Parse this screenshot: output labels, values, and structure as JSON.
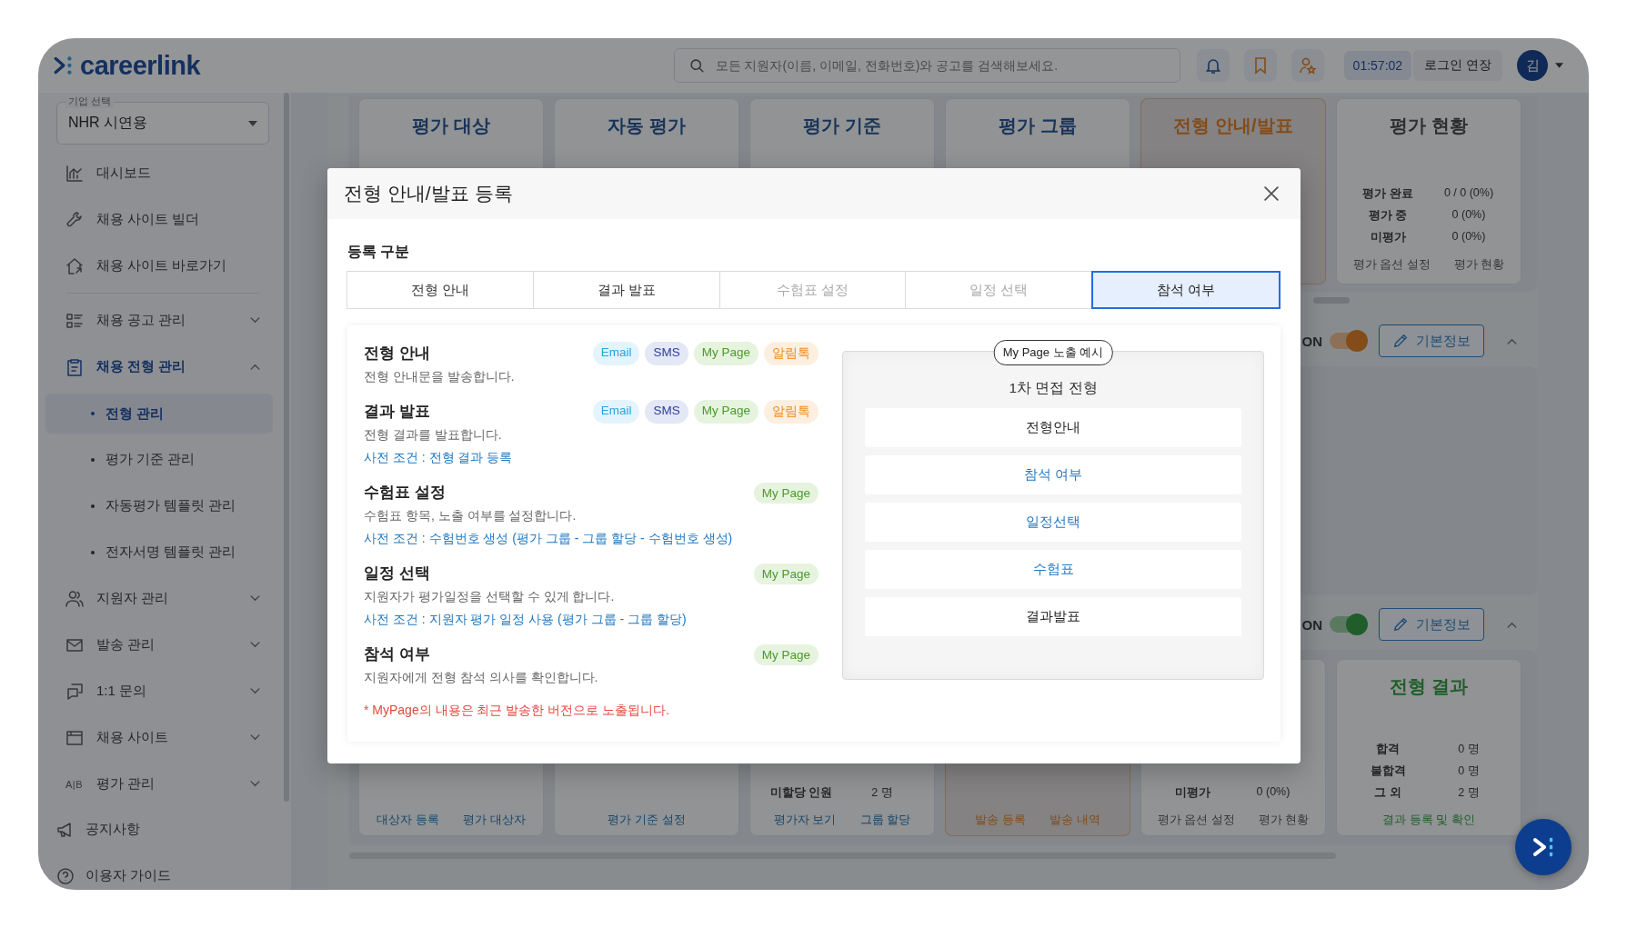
{
  "header": {
    "logo": "careerlink",
    "search": {
      "placeholder": "모든 지원자(이름, 이메일, 전화번호)와 공고를 검색해보세요."
    },
    "timer": "01:57:02",
    "extend_button": "로그인 연장",
    "avatar": "김"
  },
  "sidebar": {
    "company_select": {
      "label": "기업 선택",
      "value": "NHR 시연용"
    },
    "items": [
      {
        "label": "대시보드",
        "selected": false
      },
      {
        "label": "채용 사이트 빌더",
        "selected": false
      },
      {
        "label": "채용 사이트 바로가기",
        "selected": false
      },
      {
        "label": "채용 공고 관리",
        "selected": false,
        "expanded": false
      },
      {
        "label": "채용 전형 관리",
        "selected": true,
        "expanded": true,
        "children": [
          {
            "label": "전형 관리",
            "selected": true
          },
          {
            "label": "평가 기준 관리",
            "selected": false
          },
          {
            "label": "자동평가 템플릿 관리",
            "selected": false
          },
          {
            "label": "전자서명 템플릿 관리",
            "selected": false
          }
        ]
      },
      {
        "label": "지원자 관리",
        "selected": false,
        "expanded": false
      },
      {
        "label": "발송 관리",
        "selected": false,
        "expanded": false
      },
      {
        "label": "1:1 문의",
        "selected": false,
        "expanded": false
      },
      {
        "label": "채용 사이트",
        "selected": false,
        "expanded": false
      },
      {
        "label": "평가 관리",
        "selected": false,
        "expanded": false,
        "icon_text": "A|B"
      }
    ],
    "footer_items": [
      {
        "label": "공지사항"
      },
      {
        "label": "이용자 가이드"
      }
    ]
  },
  "board": {
    "rows": [
      {
        "cards": [
          {
            "title": "평가 대상",
            "kind": "evaluation",
            "highlighted": false
          },
          {
            "title": "자동 평가",
            "kind": "evaluation",
            "highlighted": false
          },
          {
            "title": "평가 기준",
            "kind": "evaluation",
            "highlighted": false
          },
          {
            "title": "평가 그룹",
            "kind": "evaluation",
            "highlighted": false
          },
          {
            "title": "전형 안내/발표",
            "kind": "notice",
            "highlighted": true
          },
          {
            "title": "평가 현황",
            "kind": "status",
            "highlighted": false,
            "stats": [
              {
                "label": "평가 완료",
                "value": "0 / 0 (0%)"
              },
              {
                "label": "평가 중",
                "value": "0 (0%)"
              },
              {
                "label": "미평가",
                "value": "0 (0%)"
              }
            ],
            "links": [
              "평가 옵션 설정",
              "평가 현황"
            ]
          }
        ]
      },
      {
        "kind": "notice",
        "toggle": {
          "label": "ON",
          "on": true
        },
        "edit_button": "기본정보",
        "expanded": true
      },
      {
        "kind": "result",
        "toggle": {
          "label": "ON",
          "on": true
        },
        "edit_button": "기본정보",
        "expanded": true,
        "cards": [
          {
            "kind": "evaluation",
            "highlighted": false,
            "links": [
              "대상자 등록",
              "평가 대상자"
            ]
          },
          {
            "kind": "evaluation",
            "highlighted": false,
            "links": [
              "평가 기준 설정"
            ]
          },
          {
            "kind": "evaluation",
            "highlighted": false,
            "stats": [
              {
                "label": "미할당 인원",
                "value": "2 명"
              }
            ],
            "links": [
              "평가자 보기",
              "그룹 할당"
            ]
          },
          {
            "kind": "notice",
            "highlighted": true,
            "links": [
              "발송 등록",
              "발송 내역"
            ]
          },
          {
            "kind": "status",
            "highlighted": false,
            "stats": [
              {
                "label": "미평가",
                "value": "0 (0%)"
              }
            ],
            "links": [
              "평가 옵션 설정",
              "평가 현황"
            ]
          },
          {
            "title": "전형 결과",
            "kind": "result",
            "highlighted": false,
            "stats": [
              {
                "label": "합격",
                "value": "0 명"
              },
              {
                "label": "불합격",
                "value": "0 명"
              },
              {
                "label": "그 외",
                "value": "2 명"
              }
            ],
            "links": [
              "결과 등록 및 확인"
            ]
          }
        ]
      }
    ]
  },
  "modal": {
    "title": "전형 안내/발표 등록",
    "section_label": "등록 구분",
    "tabs": [
      {
        "label": "전형 안내",
        "selected": false,
        "disabled": false
      },
      {
        "label": "결과 발표",
        "selected": false,
        "disabled": false
      },
      {
        "label": "수험표 설정",
        "selected": false,
        "disabled": true
      },
      {
        "label": "일정 선택",
        "selected": false,
        "disabled": true
      },
      {
        "label": "참석 여부",
        "selected": true,
        "disabled": false
      }
    ],
    "items": [
      {
        "title": "전형 안내",
        "description": "전형 안내문을 발송합니다.",
        "channels": [
          {
            "label": "Email",
            "kind": "email"
          },
          {
            "label": "SMS",
            "kind": "sms"
          },
          {
            "label": "My Page",
            "kind": "mypage"
          },
          {
            "label": "알림톡",
            "kind": "talk"
          }
        ]
      },
      {
        "title": "결과 발표",
        "description": "전형 결과를 발표합니다.",
        "prerequisite": "사전 조건 : 전형 결과 등록",
        "channels": [
          {
            "label": "Email",
            "kind": "email"
          },
          {
            "label": "SMS",
            "kind": "sms"
          },
          {
            "label": "My Page",
            "kind": "mypage"
          },
          {
            "label": "알림톡",
            "kind": "talk"
          }
        ]
      },
      {
        "title": "수험표 설정",
        "description": "수험표 항목, 노출 여부를 설정합니다.",
        "prerequisite": "사전 조건 : 수험번호 생성 (평가 그룹 - 그룹 할당 - 수험번호 생성)",
        "channels": [
          {
            "label": "My Page",
            "kind": "mypage"
          }
        ]
      },
      {
        "title": "일정 선택",
        "description": "지원자가 평가일정을 선택할 수 있게 합니다.",
        "prerequisite": "사전 조건 : 지원자 평가 일정 사용 (평가 그룹 - 그룹 할당)",
        "channels": [
          {
            "label": "My Page",
            "kind": "mypage"
          }
        ]
      },
      {
        "title": "참석 여부",
        "description": "지원자에게 전형 참석 의사를 확인합니다.",
        "channels": [
          {
            "label": "My Page",
            "kind": "mypage"
          }
        ]
      }
    ],
    "note": "* MyPage의 내용은 최근 발송한 버전으로 노출됩니다.",
    "preview": {
      "badge": "My Page 노출 예시",
      "title": "1차 면접 전형",
      "items": [
        {
          "label": "전형안내",
          "highlighted": false
        },
        {
          "label": "참석 여부",
          "highlighted": true
        },
        {
          "label": "일정선택",
          "highlighted": true
        },
        {
          "label": "수험표",
          "highlighted": true
        },
        {
          "label": "결과발표",
          "highlighted": false
        }
      ]
    }
  }
}
